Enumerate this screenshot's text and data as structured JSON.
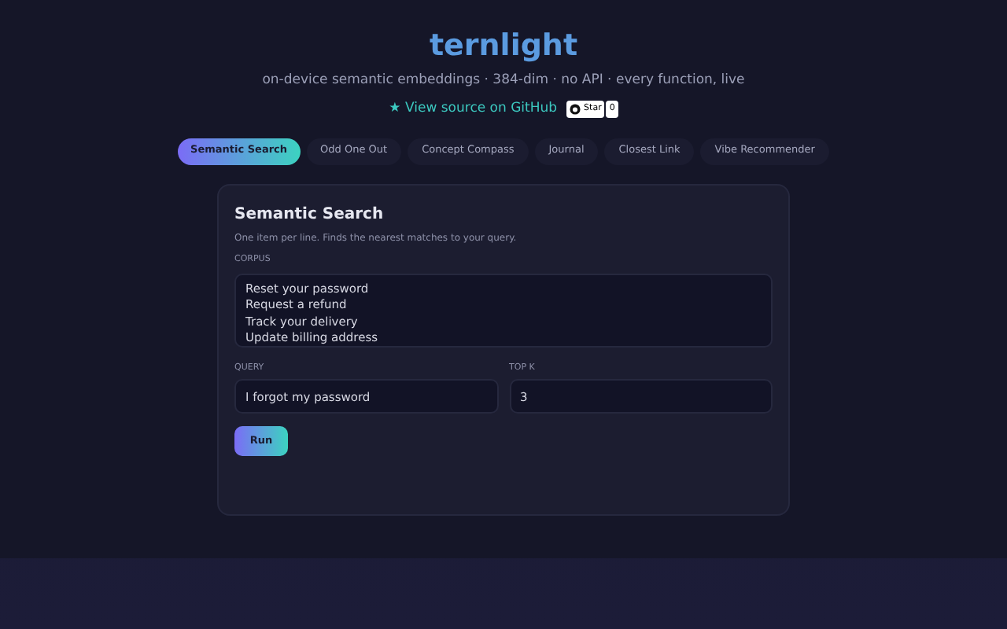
{
  "header": {
    "title": "ternlight",
    "subtitle": "on-device semantic embeddings · 384-dim · no API · every function, live",
    "source_link": "★ View source on GitHub",
    "star_button": "Star",
    "star_count": "0"
  },
  "tabs": [
    {
      "label": "Semantic Search",
      "selected": true
    },
    {
      "label": "Odd One Out",
      "selected": false
    },
    {
      "label": "Concept Compass",
      "selected": false
    },
    {
      "label": "Journal",
      "selected": false
    },
    {
      "label": "Closest Link",
      "selected": false
    },
    {
      "label": "Vibe Recommender",
      "selected": false
    }
  ],
  "panel": {
    "title": "Semantic Search",
    "description": "One item per line. Finds the nearest matches to your query.",
    "corpus_label": "CORPUS",
    "corpus": [
      "Reset your password",
      "Request a refund",
      "Track your delivery",
      "Update billing address"
    ],
    "query_label": "QUERY",
    "query": "I forgot my password",
    "topk_label": "TOP K",
    "topk": "3",
    "run_button": "Run"
  }
}
